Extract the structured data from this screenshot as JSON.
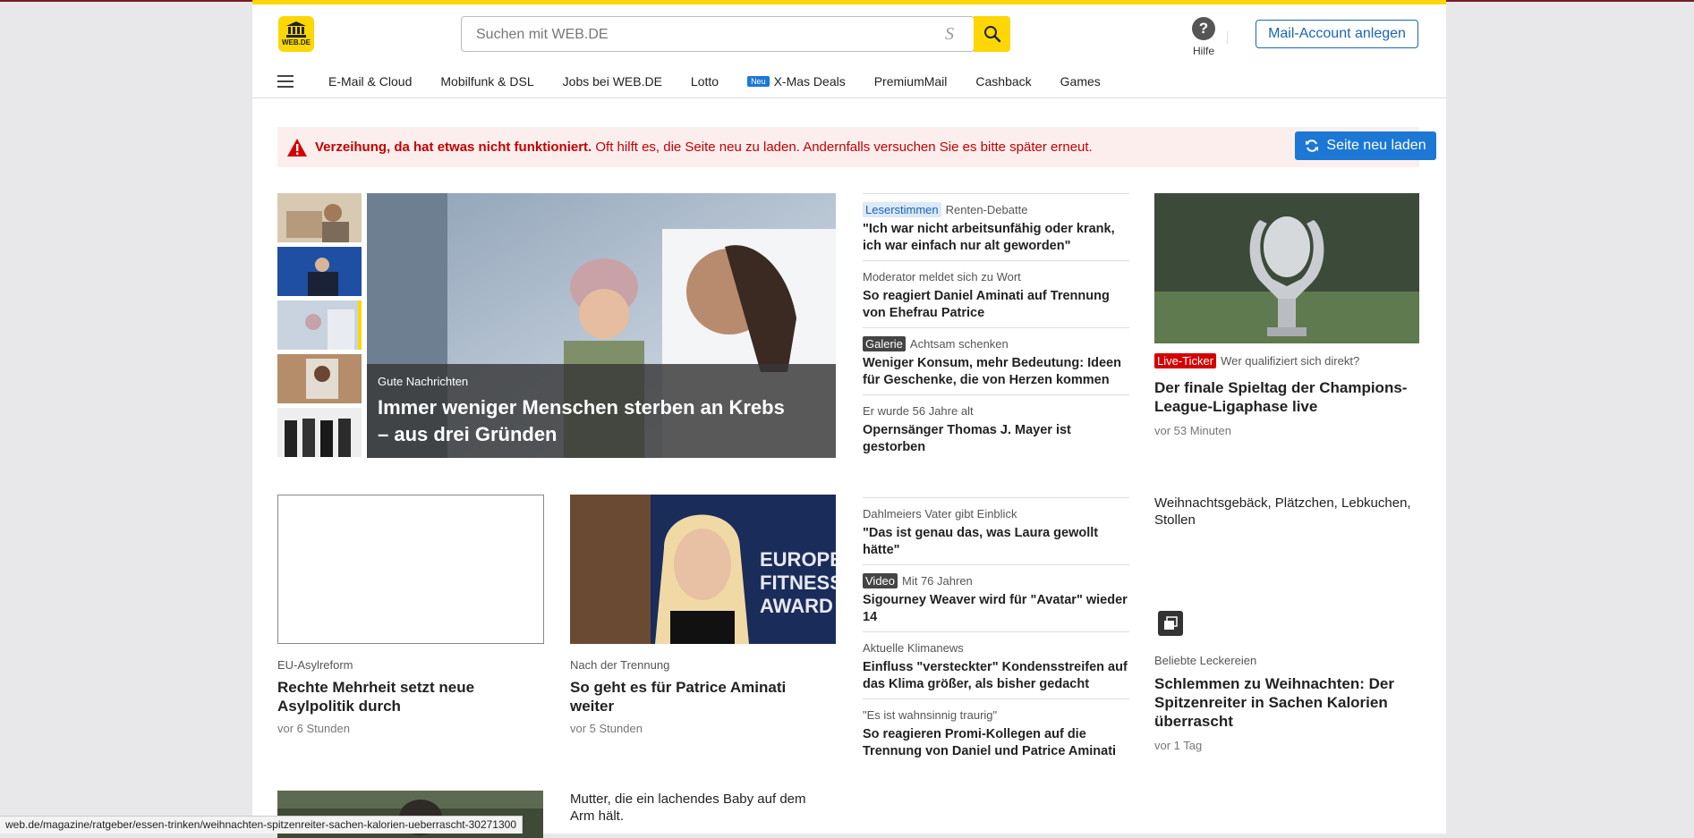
{
  "header": {
    "logo_text": "WEB.DE",
    "search_placeholder": "Suchen mit WEB.DE",
    "help_label": "Hilfe",
    "help_glyph": "?",
    "mail_account_button": "Mail-Account anlegen"
  },
  "nav": {
    "items": [
      "E-Mail & Cloud",
      "Mobilfunk & DSL",
      "Jobs bei WEB.DE",
      "Lotto",
      "X-Mas Deals",
      "PremiumMail",
      "Cashback",
      "Games"
    ],
    "new_badge": "Neu"
  },
  "alert": {
    "bold": "Verzeihung, da hat etwas nicht funktioniert.",
    "text": " Oft hilft es, die Seite neu zu laden. Andernfalls versuchen Sie es bitte später erneut.",
    "reload_button": "Seite neu laden"
  },
  "hero": {
    "kicker": "Gute Nachrichten",
    "title": "Immer weniger Menschen sterben an Krebs – aus drei Gründen"
  },
  "news_top": [
    {
      "tag": "Leserstimmen",
      "kicker": "Renten-Debatte",
      "title": "\"Ich war nicht arbeitsunfähig oder krank, ich war einfach nur alt geworden\""
    },
    {
      "tag": "",
      "kicker": "Moderator meldet sich zu Wort",
      "title": "So reagiert Daniel Aminati auf Trennung von Ehefrau Patrice"
    },
    {
      "tag": "Galerie",
      "kicker": "Achtsam schenken",
      "title": "Weniger Konsum, mehr Bedeutung: Ideen für Geschenke, die von Herzen kommen"
    },
    {
      "tag": "",
      "kicker": "Er wurde 56 Jahre alt",
      "title": "Opernsänger Thomas J. Mayer ist gestorben"
    }
  ],
  "news_bottom": [
    {
      "tag": "",
      "kicker": "Dahlmeiers Vater gibt Einblick",
      "title": "\"Das ist genau das, was Laura gewollt hätte\""
    },
    {
      "tag": "Video",
      "kicker": "Mit 76 Jahren",
      "title": "Sigourney Weaver wird für \"Avatar\" wieder 14"
    },
    {
      "tag": "",
      "kicker": "Aktuelle Klimanews",
      "title": "Einfluss \"versteckter\" Kondensstreifen auf das Klima größer, als bisher gedacht"
    },
    {
      "tag": "",
      "kicker": "\"Es ist wahnsinnig traurig\"",
      "title": "So reagieren Promi-Kollegen auf die Trennung von Daniel und Patrice Aminati"
    }
  ],
  "right": {
    "live_tag": "Live-Ticker",
    "live_kicker": "Wer qualifiziert sich direkt?",
    "live_title": "Der finale Spieltag der Champions-League-Ligaphase live",
    "live_time": "vor 53 Minuten",
    "alt_text": "Weihnachtsgebäck, Plätzchen, Lebkuchen, Stollen",
    "kicker": "Beliebte Leckereien",
    "title": "Schlemmen zu Weihnachten: Der Spitzenreiter in Sachen Kalorien überrascht",
    "time": "vor 1 Tag"
  },
  "cards": [
    {
      "kicker": "EU-Asylreform",
      "title": "Rechte Mehrheit setzt neue Asylpolitik durch",
      "time": "vor 6 Stunden"
    },
    {
      "kicker": "Nach der Trennung",
      "title": "So geht es für Patrice Aminati weiter",
      "time": "vor 5 Stunden"
    }
  ],
  "card2_image_text": "EUROPEAN FITNESS AWARD",
  "bottom_alt": "Mutter, die ein lachendes Baby auf dem Arm hält.",
  "status_url": "web.de/magazine/ratgeber/essen-trinken/weihnachten-spitzenreiter-sachen-kalorien-ueberrascht-30271300",
  "colors": {
    "brand_yellow": "#fcd703",
    "accent_blue": "#1c78d4",
    "alert_red": "#c40000"
  }
}
